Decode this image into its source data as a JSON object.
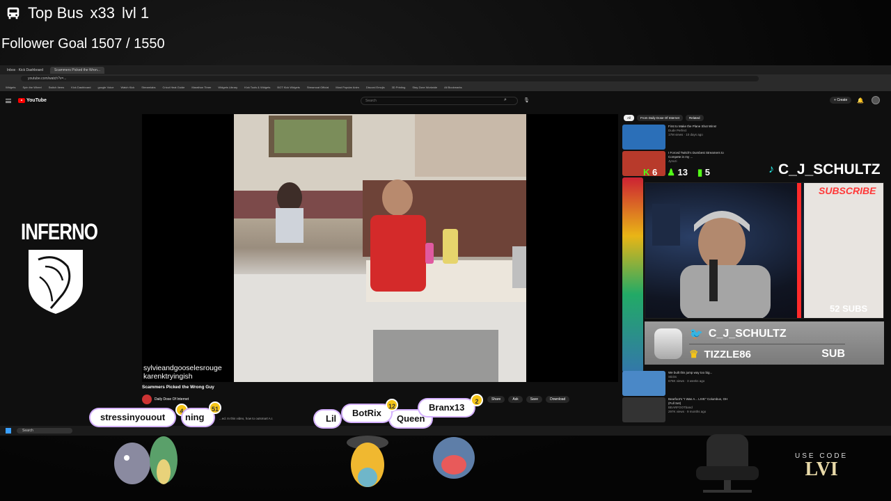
{
  "overlay": {
    "bus_label": "Top Bus",
    "bus_count": "x33",
    "bus_level": "lvl 1",
    "follower_goal": "Follower Goal 1507 / 1550"
  },
  "browser": {
    "tabs": [
      "Inbox · Kick Dashboard",
      "Scammers Picked the Wron..."
    ],
    "address": "youtube.com/watch?v=...",
    "bookmarks": [
      "Widgets",
      "Spin the Wheel",
      "Switch Items",
      "Kick Dashboard",
      "google Voice",
      "Watch Kick",
      "Streamlabs",
      "Cricut Heat Guide",
      "Marathon Timer",
      "Widgets Library",
      "Kick Tools & Widgets",
      "BOT Kick Widgets",
      "Streamcat Official",
      "Most Popular Anim",
      "Discord Emojis",
      "3D Printing",
      "Stay Zone Worlwide",
      "All Bookmarks"
    ]
  },
  "youtube": {
    "logo": "YouTube",
    "search_placeholder": "Search",
    "create_label": "Create",
    "video": {
      "caption_line1": "sylvieandgooselesrouge",
      "caption_line2": "karenktryingish",
      "title": "Scammers Picked the Wrong Guy",
      "channel": "Daily Dose Of Internet",
      "description_snippet": "...ed. In this video, how to outsmart A.I.",
      "actions": [
        "Share",
        "Ask",
        "Save",
        "Download"
      ]
    },
    "chips": [
      "All",
      "From Daily Dose Of Internet",
      "Related"
    ],
    "recommendations": [
      {
        "title": "First to Make the Plane Shot Wins!",
        "channel": "Dude Perfect",
        "meta": "17M views · 10 days ago",
        "color": "#2b6fb8"
      },
      {
        "title": "I Forced Twitch's Dumbest Streamers to Compete in my ...",
        "channel": "Jynxzi",
        "meta": "",
        "color": "#b83a2b"
      },
      {
        "title": "We built this jump way too big...",
        "channel": "Sticks",
        "meta": "676K views · 3 weeks ago",
        "color": "#4a88c7"
      },
      {
        "title": "Bearfoot's \"I Was A... LIVE\" Columbus, OH (Full Set)",
        "channel": "BEARFOOTband",
        "meta": "297K views · 9 months ago",
        "color": "#333333"
      }
    ]
  },
  "stream": {
    "kick_count": "6",
    "follower_count": "13",
    "viewer_count": "5",
    "streamer_name": "C_J_SCHULTZ",
    "subscribe_banner": "SUBSCRIBE",
    "subs_count": "52 SUBS",
    "twitter_handle": "C_J_SCHULTZ",
    "latest_sub": "TIZZLE86",
    "sub_label": "SUB",
    "sponsor_logo": "INFERNO",
    "use_code_label": "USE CODE",
    "use_code_value": "LVI"
  },
  "chat_bubbles": [
    {
      "name": "stressinyouout",
      "badge": "4"
    },
    {
      "name": "ning",
      "badge": "51"
    },
    {
      "name": "Lil",
      "badge": ""
    },
    {
      "name": "BotRix",
      "badge": "12"
    },
    {
      "name": "Queen",
      "badge": ""
    },
    {
      "name": "Branx13",
      "badge": "2"
    }
  ],
  "taskbar": {
    "search_placeholder": "Search"
  },
  "colors": {
    "kick_green": "#53fc18",
    "youtube_red": "#ff0000",
    "subscribe_red": "#ff3838",
    "twitter_blue": "#1da1f2",
    "crown_gold": "#f5c518"
  }
}
